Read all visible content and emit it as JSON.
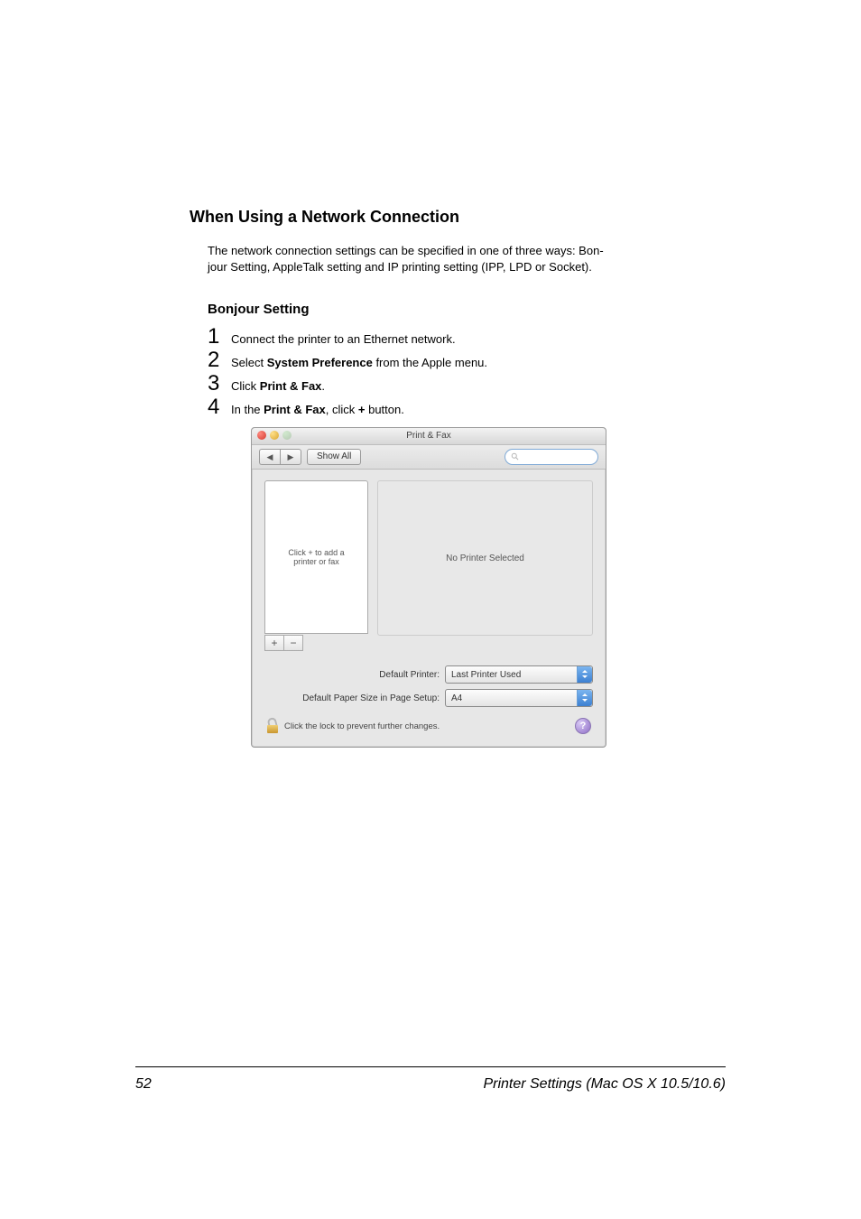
{
  "section_heading": "When Using a Network Connection",
  "intro_lines": [
    "The network connection settings can be specified in one of three ways: Bon-",
    "jour Setting, AppleTalk setting and IP printing setting (IPP, LPD or Socket)."
  ],
  "sub_heading": "Bonjour Setting",
  "steps": [
    {
      "num": "1",
      "parts": [
        "Connect the printer to an Ethernet network."
      ]
    },
    {
      "num": "2",
      "parts": [
        "Select ",
        {
          "b": "System Preference"
        },
        " from the Apple menu."
      ]
    },
    {
      "num": "3",
      "parts": [
        "Click ",
        {
          "b": "Print & Fax"
        },
        "."
      ]
    },
    {
      "num": "4",
      "parts": [
        "In the ",
        {
          "b": "Print & Fax"
        },
        ", click ",
        {
          "b": "+"
        },
        " button."
      ]
    }
  ],
  "prefs": {
    "title": "Print & Fax",
    "toolbar": {
      "back_glyph": "◀",
      "fwd_glyph": "▶",
      "show_all": "Show All"
    },
    "list_hint": "Click + to add a\nprinter or fax",
    "detail_empty": "No Printer Selected",
    "plus_glyph": "+",
    "minus_glyph": "−",
    "default_printer_label": "Default Printer:",
    "default_printer_value": "Last Printer Used",
    "default_paper_label": "Default Paper Size in Page Setup:",
    "default_paper_value": "A4",
    "lock_text": "Click the lock to prevent further changes.",
    "help_glyph": "?"
  },
  "footer": {
    "page_number": "52",
    "running_title": "Printer Settings (Mac OS X 10.5/10.6)"
  }
}
